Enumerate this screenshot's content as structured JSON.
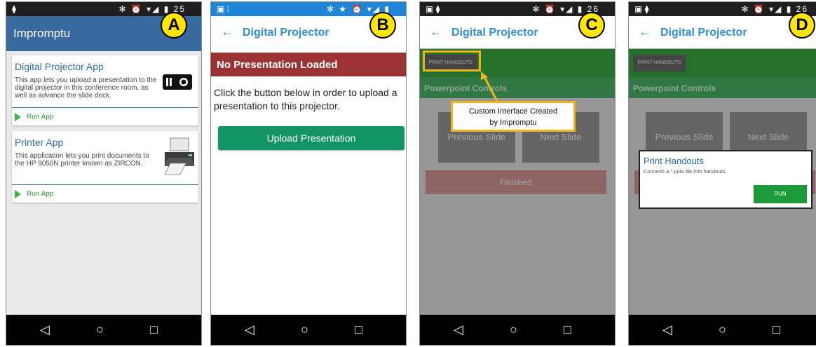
{
  "phone_a": {
    "label": "A",
    "status_right": "✻ ⏰ ▾◢ ▮ 25",
    "title": "Impromptu",
    "cards": [
      {
        "title": "Digital Projector App",
        "description": "This app lets you upload a presentation to the digital projector in this conference room, as well as advance the slide deck.",
        "run": "Run App",
        "icon": "projector-icon"
      },
      {
        "title": "Printer App",
        "description": "This application lets you print documents to the HP 9050N printer known as ZIRCON.",
        "run": "Run App",
        "icon": "printer-icon"
      }
    ]
  },
  "phone_b": {
    "label": "B",
    "app_title": "Digital Projector",
    "banner": "No Presentation Loaded",
    "message": "Click the button below in order to upload a presentation to this projector.",
    "button": "Upload Presentation"
  },
  "phone_c": {
    "label": "C",
    "app_title": "Digital Projector",
    "print_button": "PRINT HANDOUTS",
    "section": "Powerpoint Controls",
    "prev": "Previous Slide",
    "next": "Next Slide",
    "finished": "Finished",
    "callout_line1": "Custom Interface Created",
    "callout_line2": "by Impromptu"
  },
  "phone_d": {
    "label": "D",
    "app_title": "Digital Projector",
    "print_button": "PRINT HANDOUTS",
    "section": "Powerpoint Controls",
    "prev": "Previous Slide",
    "next": "Next Slide",
    "dialog_title": "Print Handouts",
    "dialog_desc": "Converts a *.pptx file into handouts.",
    "run": "RUN"
  },
  "colors": {
    "accent_blue": "#2e8fdb",
    "header_blue": "#386aa0",
    "callout_yellow": "#f2b31a",
    "label_yellow": "#ffe600",
    "green": "#3aad42",
    "red": "#9b3335"
  }
}
